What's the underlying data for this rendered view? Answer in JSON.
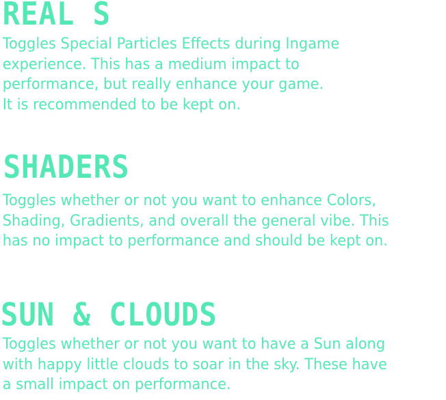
{
  "colors": {
    "accent": "#55e8b4",
    "background": "#ffffff"
  },
  "settings": [
    {
      "id": "real-s",
      "title": "REAL S",
      "description": "Toggles Special Particles Effects during Ingame\nexperience. This has a medium impact to\nperformance, but really enhance your game.\nIt is recommended to be kept on."
    },
    {
      "id": "shaders",
      "title": "SHADERS",
      "description": "Toggles whether or not you want to enhance Colors,\nShading, Gradients, and overall the general vibe. This\nhas no impact to performance and should be kept on."
    },
    {
      "id": "sun-clouds",
      "title": "SUN & CLOUDS",
      "description": "Toggles whether or not you want to have a Sun along\nwith happy little clouds to soar in the sky. These have\na small impact on performance."
    }
  ]
}
